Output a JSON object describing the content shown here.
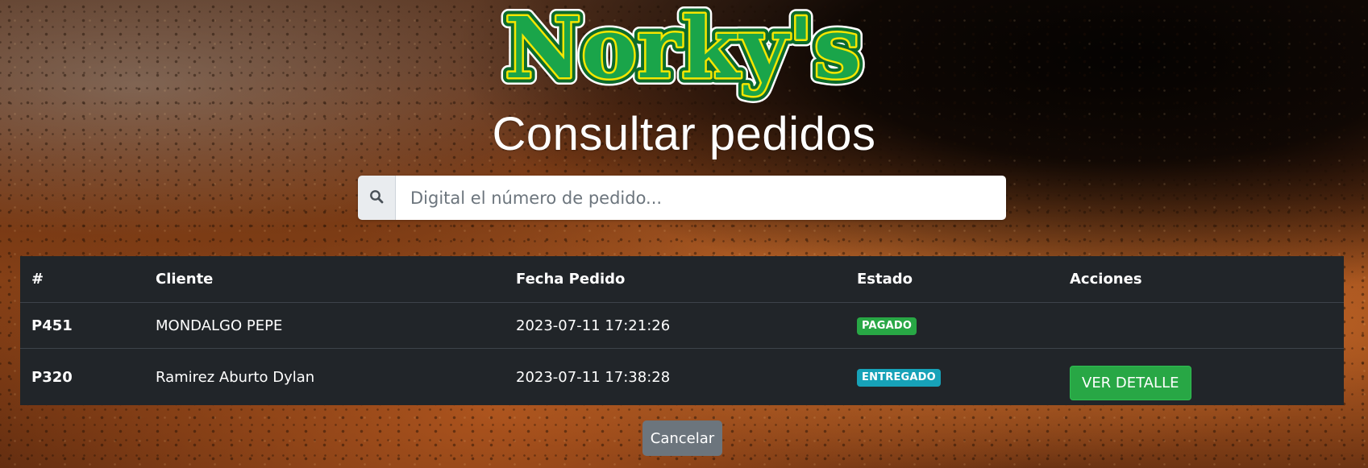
{
  "brand": {
    "logo_text": "Norky's",
    "logo_colors": {
      "fill": "#1aa54a",
      "inner_outline": "#f5e600",
      "outer_outline": "#0c6b2c"
    }
  },
  "page": {
    "title": "Consultar pedidos"
  },
  "search": {
    "icon": "search-icon",
    "placeholder": "Digital el número de pedido...",
    "value": ""
  },
  "table": {
    "headers": {
      "id": "#",
      "cliente": "Cliente",
      "fecha": "Fecha Pedido",
      "estado": "Estado",
      "acciones": "Acciones"
    },
    "rows": [
      {
        "id": "P451",
        "cliente": "MONDALGO PEPE",
        "fecha": "2023-07-11 17:21:26",
        "estado": "PAGADO",
        "estado_color": "#28a745",
        "accion": ""
      },
      {
        "id": "P320",
        "cliente": "Ramirez Aburto Dylan",
        "fecha": "2023-07-11 17:38:28",
        "estado": "ENTREGADO",
        "estado_color": "#17a2b8",
        "accion": "VER DETALLE"
      }
    ]
  },
  "actions": {
    "cancel_label": "Cancelar"
  },
  "colors": {
    "table_bg": "#212529",
    "success": "#28a745",
    "info": "#17a2b8",
    "secondary": "#6c757d"
  }
}
